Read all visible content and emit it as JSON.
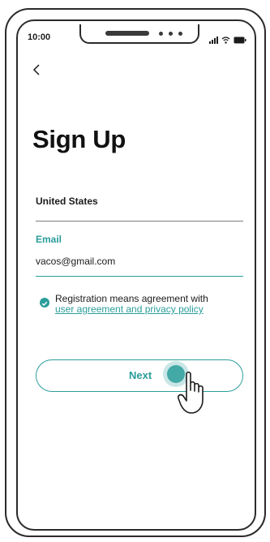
{
  "status_bar": {
    "time": "10:00"
  },
  "header": {
    "back_icon": "chevron-left-icon"
  },
  "page": {
    "title": "Sign Up"
  },
  "form": {
    "country_value": "United States",
    "email_label": "Email",
    "email_value": "vacos@gmail.com",
    "agreement_text": "Registration means agreement with",
    "agreement_link": "user agreement and privacy policy",
    "agreement_checked": true
  },
  "actions": {
    "next_label": "Next"
  },
  "colors": {
    "accent": "#2a9d9a",
    "text": "#1b1b1b",
    "outline": "#2b2b2b"
  },
  "icons": [
    "chevron-left-icon",
    "signal-icon",
    "wifi-icon",
    "battery-icon",
    "check-icon",
    "pointing-hand-icon"
  ]
}
